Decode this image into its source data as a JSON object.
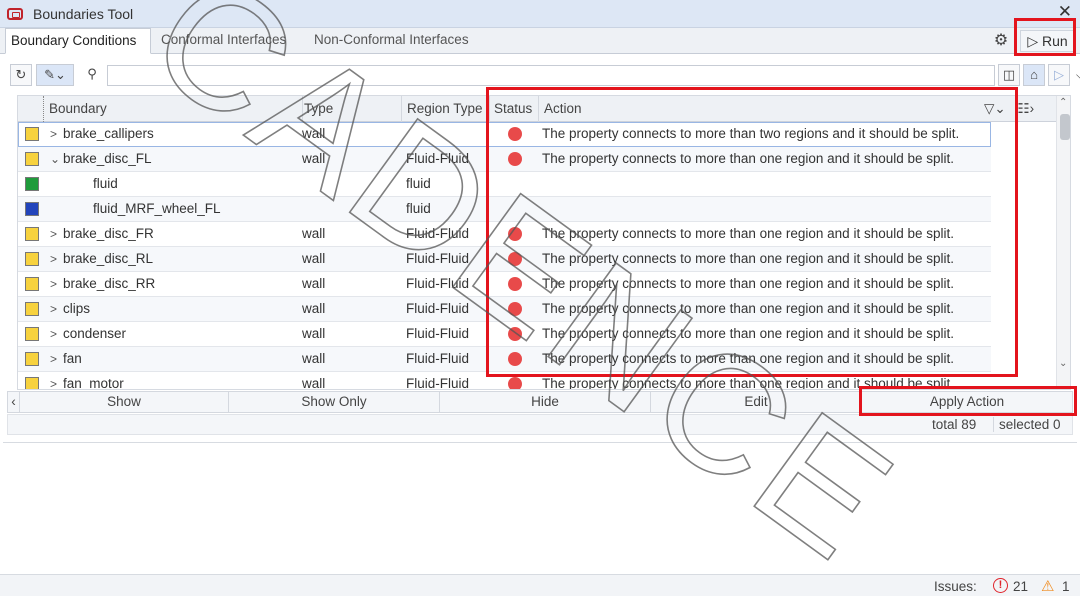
{
  "window": {
    "title": "Boundaries Tool",
    "close_glyph": "✕",
    "app_icon": "boundaries-tool-icon"
  },
  "tabs": [
    "Boundary Conditions",
    "Conformal Interfaces",
    "Non-Conformal Interfaces"
  ],
  "header_actions": {
    "settings_icon": "gear-icon",
    "run_label": "▷ Run"
  },
  "toolbar": {
    "refresh_icon": "refresh-icon",
    "edit_icon": "pencil-icon",
    "search_icon": "search-icon",
    "search_value": "",
    "dropdown_glyph": "⌵",
    "view_icons": [
      "panel-icon",
      "home-icon",
      "select-icon"
    ]
  },
  "table": {
    "columns": [
      "Boundary",
      "Type",
      "Region Type",
      "Status",
      "Action"
    ],
    "rows": [
      {
        "color": "#f7d23e",
        "expander": ">",
        "level": 0,
        "name": "brake_callipers",
        "type": "wall",
        "region_type": "",
        "status": "error",
        "action": "The property connects to more than two regions and it should be split."
      },
      {
        "color": "#f7d23e",
        "expander": "⌄",
        "level": 0,
        "name": "brake_disc_FL",
        "type": "wall",
        "region_type": "Fluid-Fluid",
        "status": "error",
        "action": "The property connects to more than one region and it should be split."
      },
      {
        "color": "#1f9b3b",
        "expander": "",
        "level": 1,
        "name": "fluid",
        "type": "",
        "region_type": "fluid",
        "status": "",
        "action": ""
      },
      {
        "color": "#2244bb",
        "expander": "",
        "level": 1,
        "name": "fluid_MRF_wheel_FL",
        "type": "",
        "region_type": "fluid",
        "status": "",
        "action": ""
      },
      {
        "color": "#f7d23e",
        "expander": ">",
        "level": 0,
        "name": "brake_disc_FR",
        "type": "wall",
        "region_type": "Fluid-Fluid",
        "status": "error",
        "action": "The property connects to more than one region and it should be split."
      },
      {
        "color": "#f7d23e",
        "expander": ">",
        "level": 0,
        "name": "brake_disc_RL",
        "type": "wall",
        "region_type": "Fluid-Fluid",
        "status": "error",
        "action": "The property connects to more than one region and it should be split."
      },
      {
        "color": "#f7d23e",
        "expander": ">",
        "level": 0,
        "name": "brake_disc_RR",
        "type": "wall",
        "region_type": "Fluid-Fluid",
        "status": "error",
        "action": "The property connects to more than one region and it should be split."
      },
      {
        "color": "#f7d23e",
        "expander": ">",
        "level": 0,
        "name": "clips",
        "type": "wall",
        "region_type": "Fluid-Fluid",
        "status": "error",
        "action": "The property connects to more than one region and it should be split."
      },
      {
        "color": "#f7d23e",
        "expander": ">",
        "level": 0,
        "name": "condenser",
        "type": "wall",
        "region_type": "Fluid-Fluid",
        "status": "error",
        "action": "The property connects to more than one region and it should be split."
      },
      {
        "color": "#f7d23e",
        "expander": ">",
        "level": 0,
        "name": "fan",
        "type": "wall",
        "region_type": "Fluid-Fluid",
        "status": "error",
        "action": "The property connects to more than one region and it should be split."
      },
      {
        "color": "#f7d23e",
        "expander": ">",
        "level": 0,
        "name": "fan_motor",
        "type": "wall",
        "region_type": "Fluid-Fluid",
        "status": "error",
        "action": "The property connects to more than one region and it should be split."
      }
    ]
  },
  "actions": [
    "Show",
    "Show Only",
    "Hide",
    "Edit",
    "Apply Action"
  ],
  "summary": {
    "total": "total 89",
    "selected": "selected 0"
  },
  "issues": {
    "label": "Issues:",
    "errors": "21",
    "warnings": "1"
  },
  "watermark_text": "CADENCE",
  "colors": {
    "highlight": "#e3141d",
    "status_error": "#e84a4a"
  }
}
